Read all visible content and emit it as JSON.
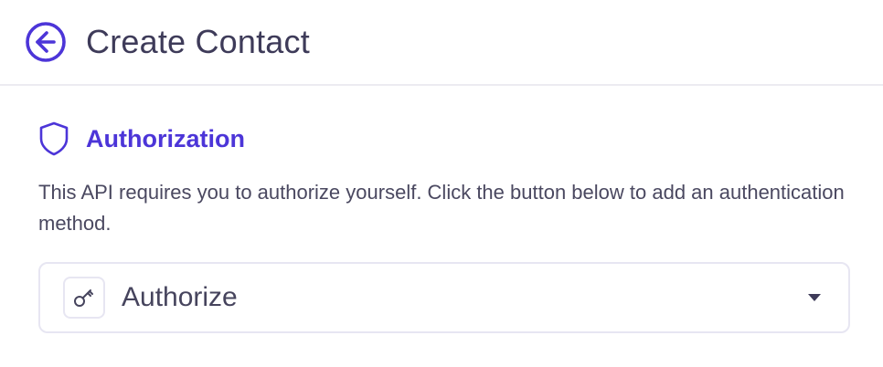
{
  "header": {
    "title": "Create Contact",
    "back_icon": "arrow-left-circle-icon"
  },
  "section": {
    "title": "Authorization",
    "icon": "shield-icon",
    "description": "This API requires you to authorize yourself. Click the button below to add an authentication method."
  },
  "authorize": {
    "label": "Authorize",
    "icon": "key-icon",
    "dropdown_icon": "caret-down-icon"
  },
  "colors": {
    "accent": "#4c35d8",
    "text_primary": "#3e3b59",
    "border": "#e7e6f2"
  }
}
